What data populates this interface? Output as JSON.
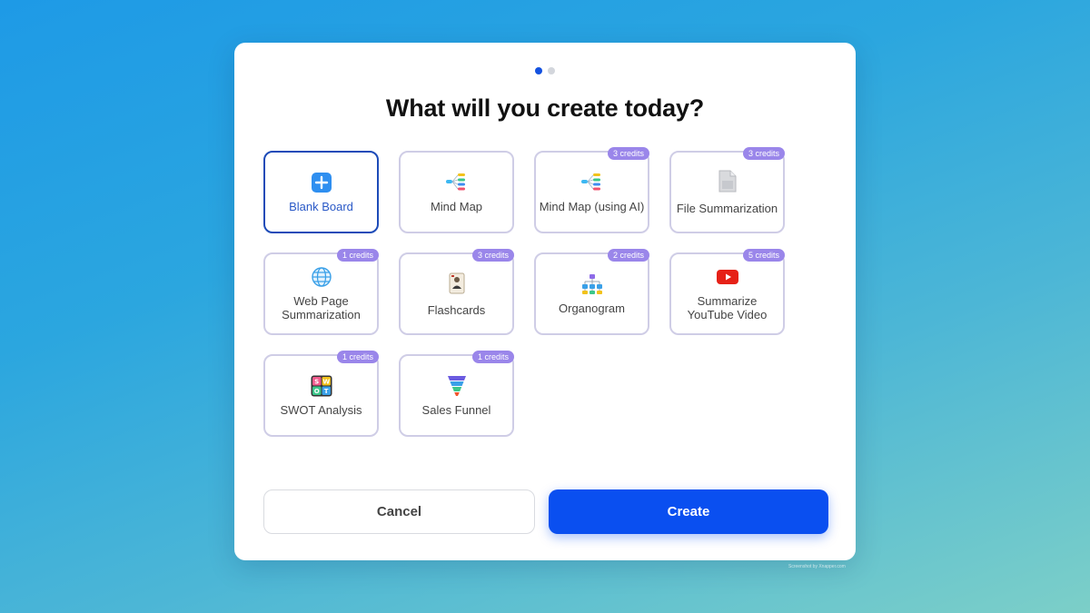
{
  "dialog": {
    "title": "What will you create today?",
    "step_indicator": {
      "current": 1,
      "total": 2
    }
  },
  "templates": [
    {
      "label": "Blank Board",
      "icon": "plus-square-icon",
      "selected": true
    },
    {
      "label": "Mind Map",
      "icon": "mind-map-icon"
    },
    {
      "label": "Mind Map (using AI)",
      "icon": "mind-map-icon",
      "badge": "3 credits"
    },
    {
      "label": "File Summarization",
      "icon": "file-icon",
      "badge": "3 credits"
    },
    {
      "label": "Web Page Summarization",
      "icon": "globe-icon",
      "badge": "1 credits"
    },
    {
      "label": "Flashcards",
      "icon": "flashcard-icon",
      "badge": "3 credits"
    },
    {
      "label": "Organogram",
      "icon": "org-chart-icon",
      "badge": "2 credits"
    },
    {
      "label": "Summarize YouTube Video",
      "icon": "youtube-icon",
      "badge": "5 credits"
    },
    {
      "label": "SWOT Analysis",
      "icon": "swot-icon",
      "badge": "1 credits"
    },
    {
      "label": "Sales Funnel",
      "icon": "funnel-icon",
      "badge": "1 credits"
    }
  ],
  "swot_letters": [
    "S",
    "W",
    "O",
    "T"
  ],
  "actions": {
    "cancel_label": "Cancel",
    "create_label": "Create"
  },
  "watermark": "Screenshot by Xnapper.com",
  "colors": {
    "primary": "#0a4ff0",
    "badge": "#9a86ea",
    "selected_border": "#1d4bb8"
  }
}
